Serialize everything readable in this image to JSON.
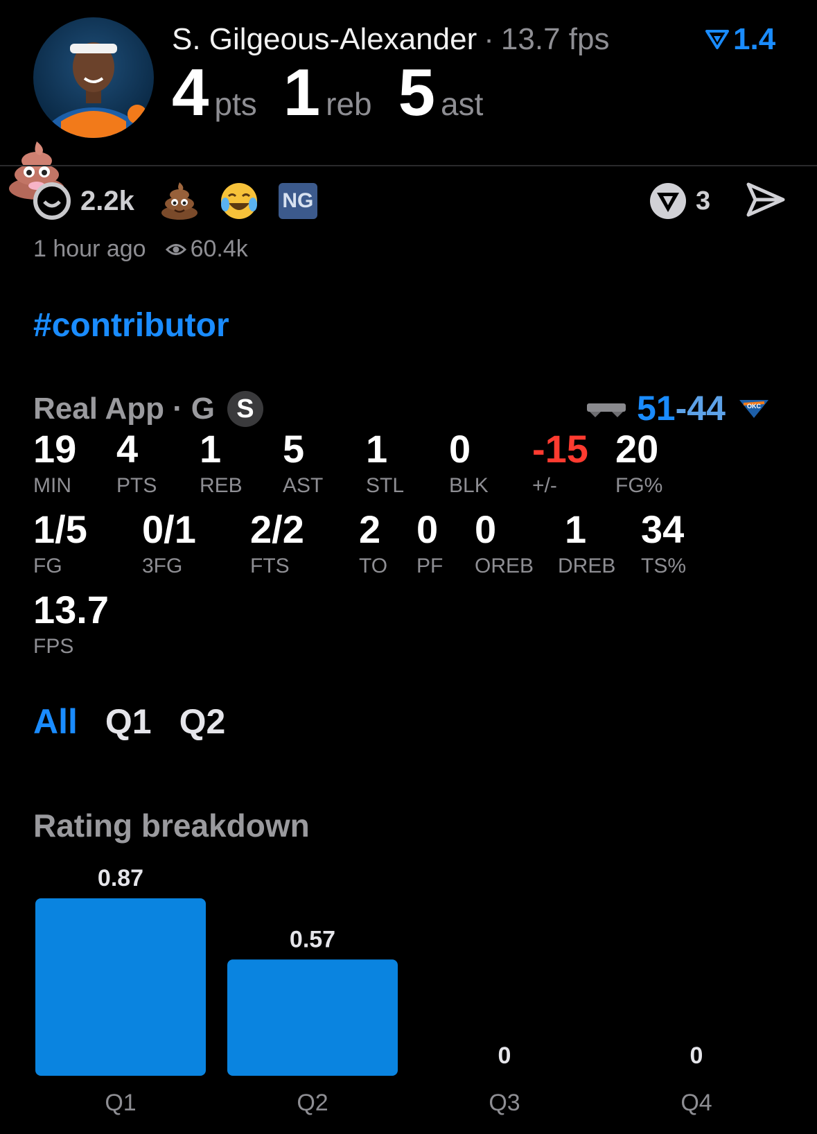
{
  "header": {
    "player_name": "S. Gilgeous-Alexander",
    "separator": "·",
    "fps_text": "13.7 fps",
    "rating": "1.4",
    "stats": [
      {
        "value": "4",
        "unit": "pts"
      },
      {
        "value": "1",
        "unit": "reb"
      },
      {
        "value": "5",
        "unit": "ast"
      }
    ]
  },
  "reactions": {
    "count": "2.2k",
    "emojis": [
      "smile-icon",
      "poop-emoji",
      "laugh-cry-emoji"
    ],
    "badge": "NG",
    "comments": "3",
    "time": "1 hour ago",
    "views": "60.4k"
  },
  "hashtag": "#contributor",
  "game": {
    "source": "Real App",
    "dot": "·",
    "position": "G",
    "badge": "S",
    "team_score": "51",
    "dash": "-",
    "opp_score": "44"
  },
  "stats_row1": [
    {
      "value": "19",
      "label": "MIN"
    },
    {
      "value": "4",
      "label": "PTS"
    },
    {
      "value": "1",
      "label": "REB"
    },
    {
      "value": "5",
      "label": "AST"
    },
    {
      "value": "1",
      "label": "STL"
    },
    {
      "value": "0",
      "label": "BLK"
    },
    {
      "value": "-15",
      "label": "+/-"
    },
    {
      "value": "20",
      "label": "FG%"
    }
  ],
  "stats_row2": [
    {
      "value": "1/5",
      "label": "FG"
    },
    {
      "value": "0/1",
      "label": "3FG"
    },
    {
      "value": "2/2",
      "label": "FTS"
    },
    {
      "value": "2",
      "label": "TO"
    },
    {
      "value": "0",
      "label": "PF"
    },
    {
      "value": "0",
      "label": "OREB"
    },
    {
      "value": "1",
      "label": "DREB"
    },
    {
      "value": "34",
      "label": "TS%"
    }
  ],
  "stats_row3": [
    {
      "value": "13.7",
      "label": "FPS"
    }
  ],
  "tabs": [
    "All",
    "Q1",
    "Q2"
  ],
  "section_title": "Rating breakdown",
  "colors": {
    "accent": "#1a8cff",
    "bar": "#0a84e0",
    "negative": "#ff3b30",
    "muted": "#8e8e93"
  },
  "chart_data": {
    "type": "bar",
    "categories": [
      "Q1",
      "Q2",
      "Q3",
      "Q4"
    ],
    "values": [
      0.87,
      0.57,
      0,
      0
    ],
    "value_labels": [
      "0.87",
      "0.57",
      "0",
      "0"
    ]
  }
}
